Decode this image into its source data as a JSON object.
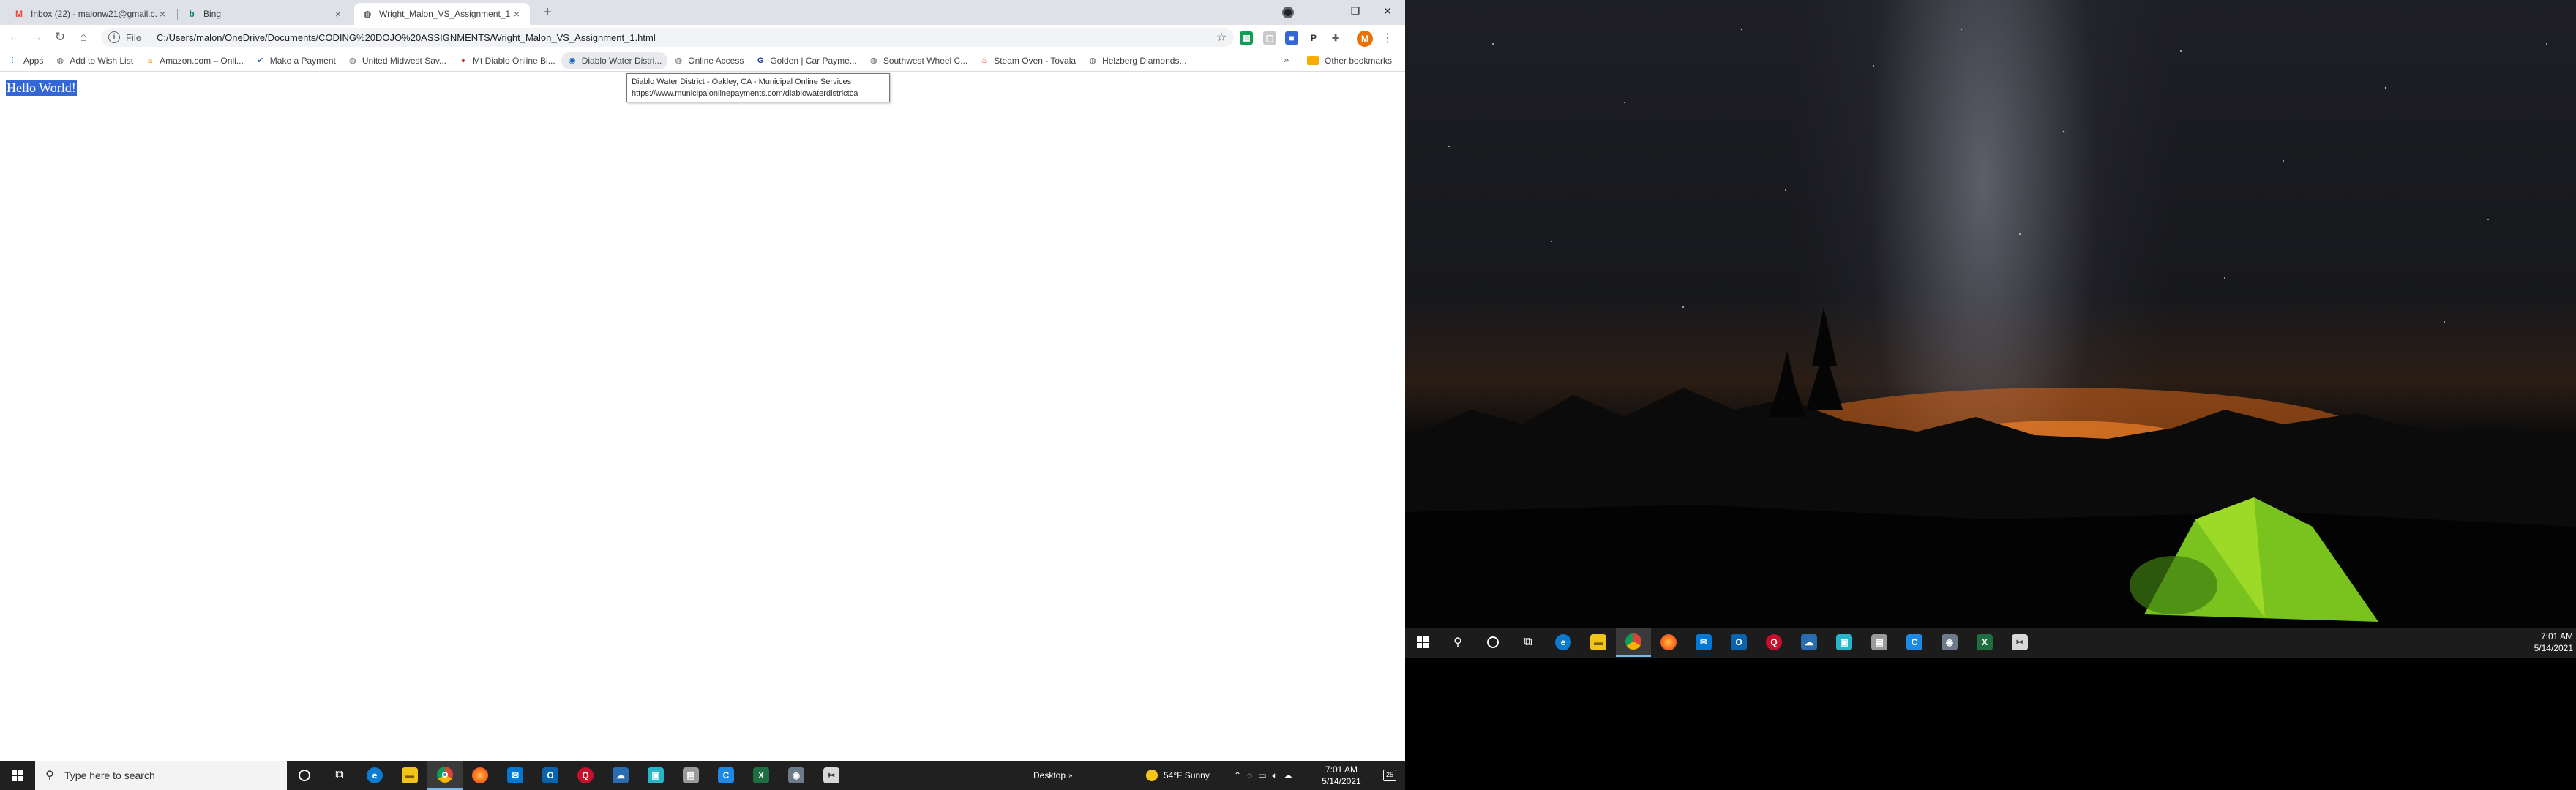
{
  "browser": {
    "tabs": [
      {
        "title": "Inbox (22) - malonw21@gmail.c...",
        "icon": "gmail-icon",
        "active": false
      },
      {
        "title": "Bing",
        "icon": "bing-icon",
        "active": false
      },
      {
        "title": "Wright_Malon_VS_Assignment_1...",
        "icon": "globe-icon",
        "active": true
      }
    ],
    "address": {
      "scheme": "File",
      "url": "C:/Users/malon/OneDrive/Documents/CODING%20DOJO%20ASSIGNMENTS/Wright_Malon_VS_Assignment_1.html"
    },
    "avatar_letter": "M",
    "bookmarks": [
      {
        "label": "Apps",
        "icon": "apps-grid-icon"
      },
      {
        "label": "Add to Wish List",
        "icon": "globe-icon"
      },
      {
        "label": "Amazon.com – Onli...",
        "icon": "amazon-icon"
      },
      {
        "label": "Make a Payment",
        "icon": "payment-icon"
      },
      {
        "label": "United Midwest Sav...",
        "icon": "globe-icon"
      },
      {
        "label": "Mt Diablo Online Bi...",
        "icon": "diablo-icon"
      },
      {
        "label": "Diablo Water Distri...",
        "icon": "water-icon"
      },
      {
        "label": "Online Access",
        "icon": "globe-icon"
      },
      {
        "label": "Golden | Car Payme...",
        "icon": "golden-icon"
      },
      {
        "label": "Southwest Wheel C...",
        "icon": "globe-icon"
      },
      {
        "label": "Steam Oven - Tovala",
        "icon": "tovala-icon"
      },
      {
        "label": "Helzberg Diamonds...",
        "icon": "globe-icon"
      }
    ],
    "other_bookmarks": "Other bookmarks",
    "more_bookmarks": "»",
    "tooltip": {
      "line1": "Diablo Water District - Oakley, CA - Municipal Online Services",
      "line2": "https://www.municipalonlinepayments.com/diablowaterdistrictca"
    }
  },
  "page": {
    "heading": "Hello World!"
  },
  "taskbar": {
    "search_placeholder": "Type here to search",
    "desktop_label": "Desktop",
    "weather": "54°F  Sunny",
    "time": "7:01 AM",
    "date": "5/14/2021",
    "notification_count": "25"
  },
  "taskbar2": {
    "time": "7:01 AM",
    "date": "5/14/2021"
  }
}
